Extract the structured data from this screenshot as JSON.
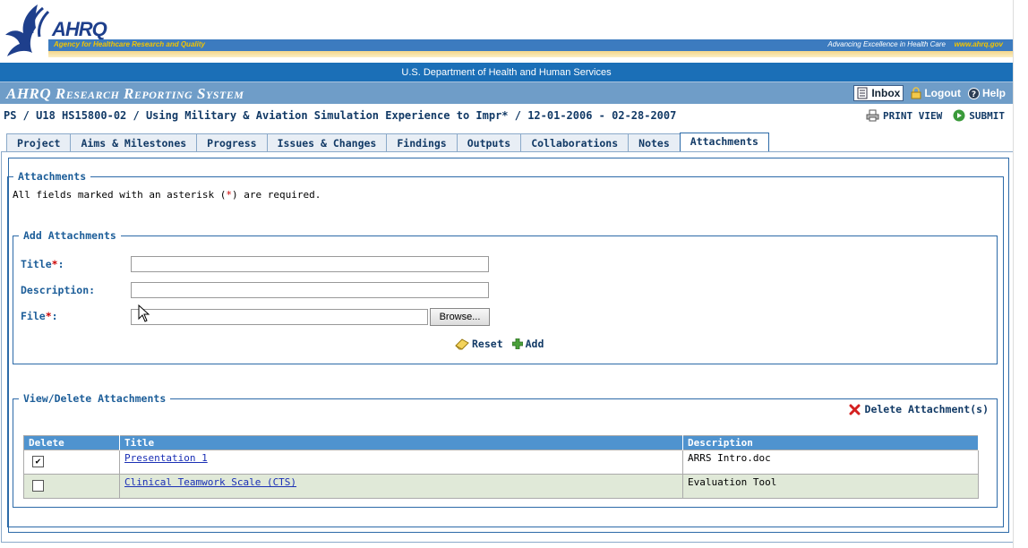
{
  "header": {
    "logo_text": "AHRQ",
    "agency": "Agency for Healthcare Research and Quality",
    "tagline": "Advancing Excellence in Health Care",
    "site_url": "www.ahrq.gov",
    "department": "U.S. Department of Health and Human Services"
  },
  "titlebar": {
    "system_title": "AHRQ Research Reporting System",
    "inbox": "Inbox",
    "logout": "Logout",
    "help": "Help"
  },
  "breadcrumb": "PS / U18 HS15800-02 / Using Military & Aviation Simulation Experience to Impr* / 12-01-2006 - 02-28-2007",
  "actions": {
    "print_view": "PRINT VIEW",
    "submit": "SUBMIT"
  },
  "tabs": [
    {
      "label": "Project",
      "active": false
    },
    {
      "label": "Aims & Milestones",
      "active": false
    },
    {
      "label": "Progress",
      "active": false
    },
    {
      "label": "Issues & Changes",
      "active": false
    },
    {
      "label": "Findings",
      "active": false
    },
    {
      "label": "Outputs",
      "active": false
    },
    {
      "label": "Collaborations",
      "active": false
    },
    {
      "label": "Notes",
      "active": false
    },
    {
      "label": "Attachments",
      "active": true
    }
  ],
  "attachments": {
    "legend": "Attachments",
    "required_note_pre": "All fields marked with an asterisk (",
    "required_note_ast": "*",
    "required_note_post": ") are required."
  },
  "add_form": {
    "legend": "Add Attachments",
    "title_label": "Title",
    "title_value": "",
    "description_label": "Description:",
    "description_value": "",
    "file_label": "File",
    "file_value": "",
    "browse_button": "Browse...",
    "required_mark": "*",
    "colon": ":",
    "reset": "Reset",
    "add": "Add"
  },
  "view_delete": {
    "legend": "View/Delete Attachments",
    "delete_link": "Delete Attachment(s)",
    "columns": [
      "Delete",
      "Title",
      "Description"
    ],
    "rows": [
      {
        "checked": true,
        "checkmark": "✔",
        "title": "Presentation 1",
        "description": "ARRS Intro.doc"
      },
      {
        "checked": false,
        "checkmark": "",
        "title": "Clinical Teamwork Scale (CTS)",
        "description": "Evaluation Tool"
      }
    ]
  },
  "colors": {
    "hhs_band": "#1b6fb7",
    "title_bar": "#6f9dc8",
    "table_header": "#4f93cf",
    "alt_row": "#e0e9d8",
    "label_blue": "#1d5e99",
    "required_red": "#cc0000"
  }
}
